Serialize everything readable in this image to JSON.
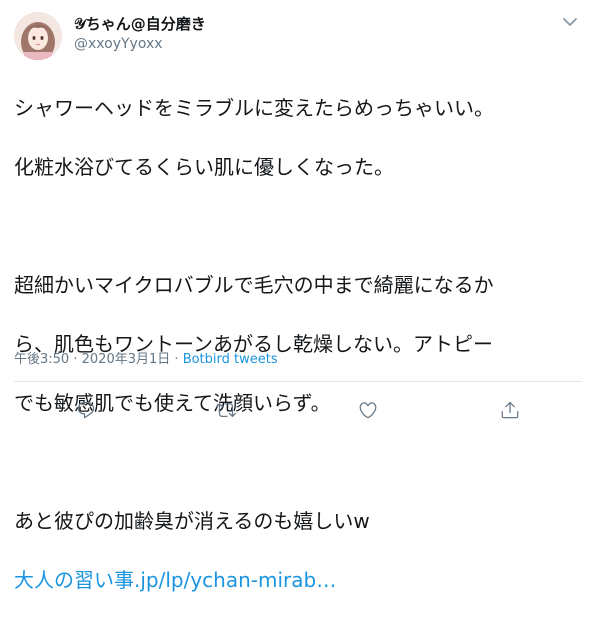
{
  "user": {
    "display_name": "𝒴ちゃん@自分磨き",
    "handle": "@xxoyYyoxx",
    "avatar_icon": "profile-avatar"
  },
  "tweet": {
    "lines": [
      "シャワーヘッドをミラブルに変えたらめっちゃいい。",
      "化粧水浴びてるくらい肌に優しくなった。",
      "",
      "超細かいマイクロバブルで毛穴の中まで綺麗になるか",
      "ら、肌色もワントーンあがるし乾燥しない。アトピー",
      "でも敏感肌でも使えて洗顔いらず。",
      "",
      "あと彼ぴの加齢臭が消えるのも嬉しいw"
    ],
    "link": "大人の習い事.jp/lp/ychan-mirab…",
    "time": "午後3:50",
    "date": "2020年3月1日",
    "separator": "·",
    "source": "Botbird tweets"
  },
  "actions": {
    "reply_icon": "reply-icon",
    "retweet_icon": "retweet-icon",
    "like_icon": "heart-icon",
    "share_icon": "share-icon"
  },
  "colors": {
    "text": "#14171a",
    "secondary": "#657786",
    "link": "#1b95e0",
    "divider": "#e1e8ed"
  }
}
